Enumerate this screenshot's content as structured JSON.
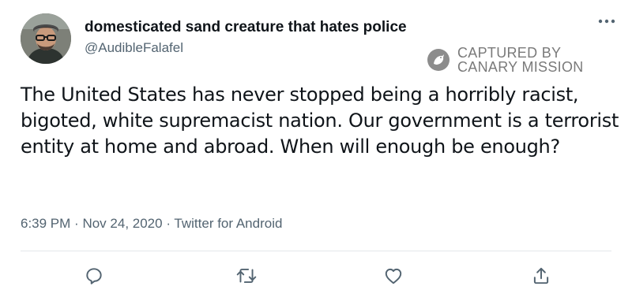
{
  "tweet": {
    "display_name": "domesticated sand creature that hates police",
    "handle": "@AudibleFalafel",
    "text": "The United States has never stopped being a horribly racist, bigoted, white supremacist nation. Our government is a terrorist entity at home and abroad. When will enough be enough?",
    "time": "6:39 PM",
    "separator": "·",
    "date": "Nov 24, 2020",
    "source": "Twitter for Android"
  },
  "watermark": {
    "line1": "CAPTURED BY",
    "line2": "CANARY MISSION"
  },
  "icons": {
    "more": "more-horizontal-icon",
    "reply": "reply-icon",
    "retweet": "retweet-icon",
    "like": "like-icon",
    "share": "share-icon"
  },
  "colors": {
    "text": "#0f1419",
    "secondary": "#536471",
    "divider": "#e3e7ea"
  }
}
